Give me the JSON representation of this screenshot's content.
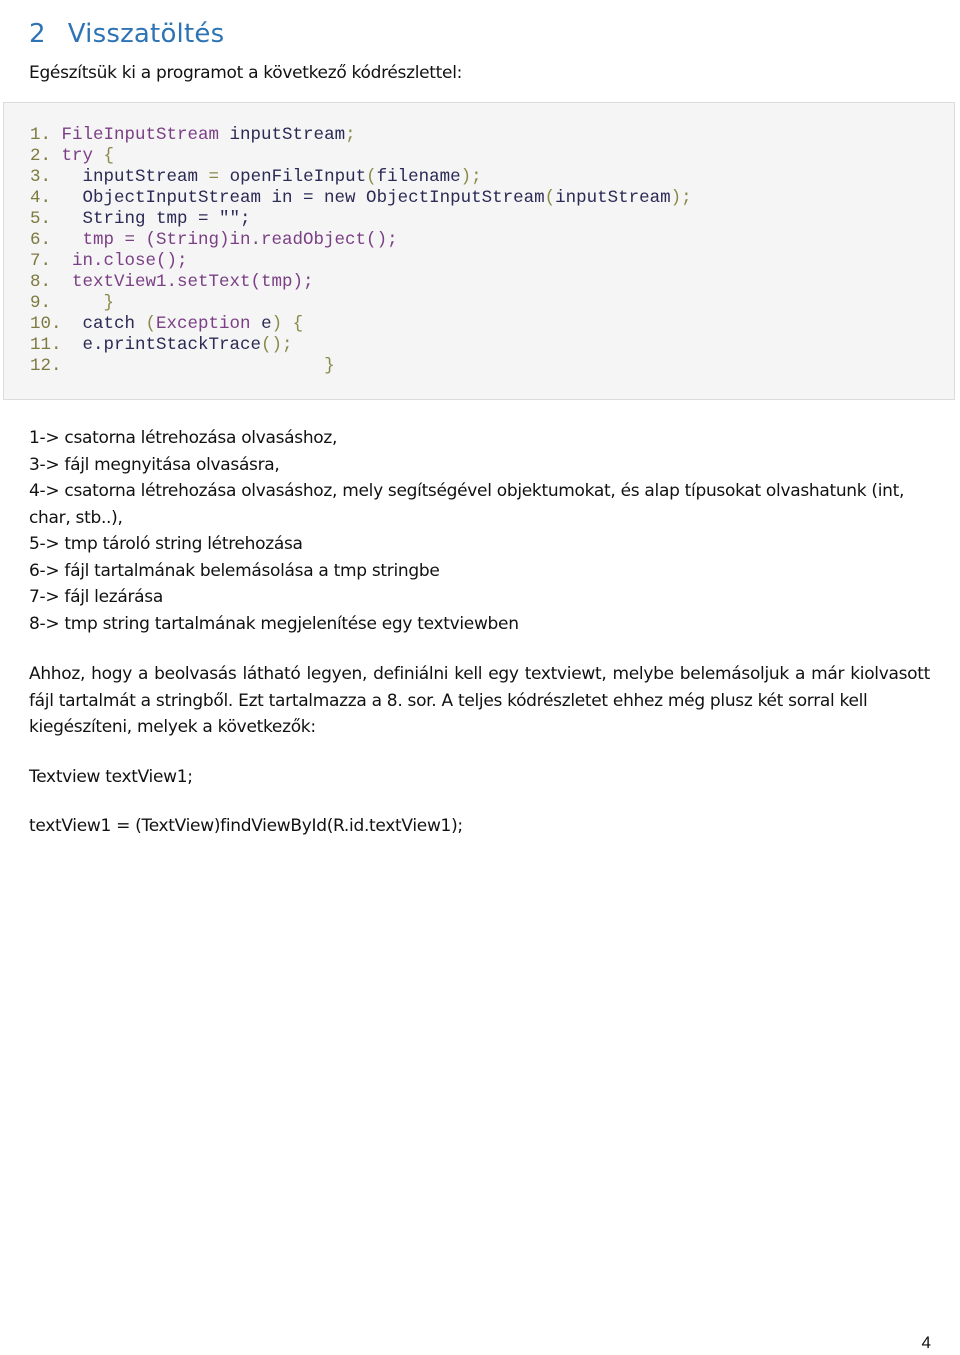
{
  "heading": {
    "number": "2",
    "title": "Visszatöltés"
  },
  "intro": "Egészítsük ki a programot a következő kódrészlettel:",
  "code_lines": [
    {
      "n": "1.",
      "indent": " ",
      "tokens": [
        [
          "kw",
          "FileInputStream"
        ],
        [
          "id",
          " inputStream"
        ],
        [
          "pu",
          ";"
        ]
      ]
    },
    {
      "n": "2.",
      "indent": " ",
      "tokens": [
        [
          "kw",
          "try"
        ],
        [
          "pu",
          " {"
        ]
      ]
    },
    {
      "n": "3.",
      "indent": "   ",
      "tokens": [
        [
          "id",
          "inputStream"
        ],
        [
          "pu",
          " = "
        ],
        [
          "id",
          "openFileInput"
        ],
        [
          "pu",
          "("
        ],
        [
          "id",
          "filename"
        ],
        [
          "pu",
          ");"
        ]
      ]
    },
    {
      "n": "4.",
      "indent": "   ",
      "tokens": [
        [
          "id",
          "ObjectInputStream in = new ObjectInputStream"
        ],
        [
          "pu",
          "("
        ],
        [
          "id",
          "inputStream"
        ],
        [
          "pu",
          ");"
        ]
      ]
    },
    {
      "n": "5.",
      "indent": "   ",
      "tokens": [
        [
          "id",
          "String tmp = \"\";"
        ]
      ]
    },
    {
      "n": "6.",
      "indent": "   ",
      "tokens": [
        [
          "kw",
          "tmp = (String)in.readObject();"
        ]
      ]
    },
    {
      "n": "7.",
      "indent": "  ",
      "tokens": [
        [
          "kw",
          "in.close();"
        ]
      ]
    },
    {
      "n": "8.",
      "indent": "  ",
      "tokens": [
        [
          "kw",
          "textView1.setText(tmp);"
        ]
      ]
    },
    {
      "n": "9.",
      "indent": "     ",
      "tokens": [
        [
          "pu",
          "}"
        ]
      ]
    },
    {
      "n": "10.",
      "indent": "  ",
      "tokens": [
        [
          "id",
          "catch "
        ],
        [
          "pu",
          "("
        ],
        [
          "kw",
          "Exception"
        ],
        [
          "id",
          " e"
        ],
        [
          "pu",
          ") {"
        ]
      ]
    },
    {
      "n": "11.",
      "indent": "  ",
      "tokens": [
        [
          "id",
          "e.printStackTrace"
        ],
        [
          "pu",
          "();"
        ]
      ]
    },
    {
      "n": "12.",
      "indent": "                         ",
      "tokens": [
        [
          "pu",
          "}"
        ]
      ]
    }
  ],
  "explanations": [
    "1-> csatorna létrehozása olvasáshoz,",
    "3-> fájl megnyitása olvasásra,",
    "4-> csatorna létrehozása olvasáshoz, mely segítségével objektumokat, és alap típusokat olvashatunk (int, char, stb..),",
    "5-> tmp tároló string létrehozása",
    "6-> fájl tartalmának belemásolása a tmp stringbe",
    "7-> fájl lezárása",
    "8-> tmp string tartalmának megjelenítése egy textviewben"
  ],
  "paragraph_main": "Ahhoz, hogy a beolvasás látható legyen, definiálni kell egy textviewt, melybe belemásoljuk a már kiolvasott fájl tartalmát a stringből. Ezt tartalmazza a 8. sor. A teljes kódrészletet ehhez még plusz két sorral kell",
  "paragraph_last": "kiegészíteni, melyek a következők:",
  "snippet_declaration": "Textview textView1;",
  "snippet_assignment": "textView1 = (TextView)findViewById(R.id.textView1);",
  "page_number": "4",
  "colors": {
    "heading": "#2e74b5",
    "code_background": "#f5f5f5",
    "keyword": "#7b3f85",
    "identifier": "#2b2a55",
    "punctuation": "#8a8a4a",
    "line_number": "#7d7a3e"
  }
}
